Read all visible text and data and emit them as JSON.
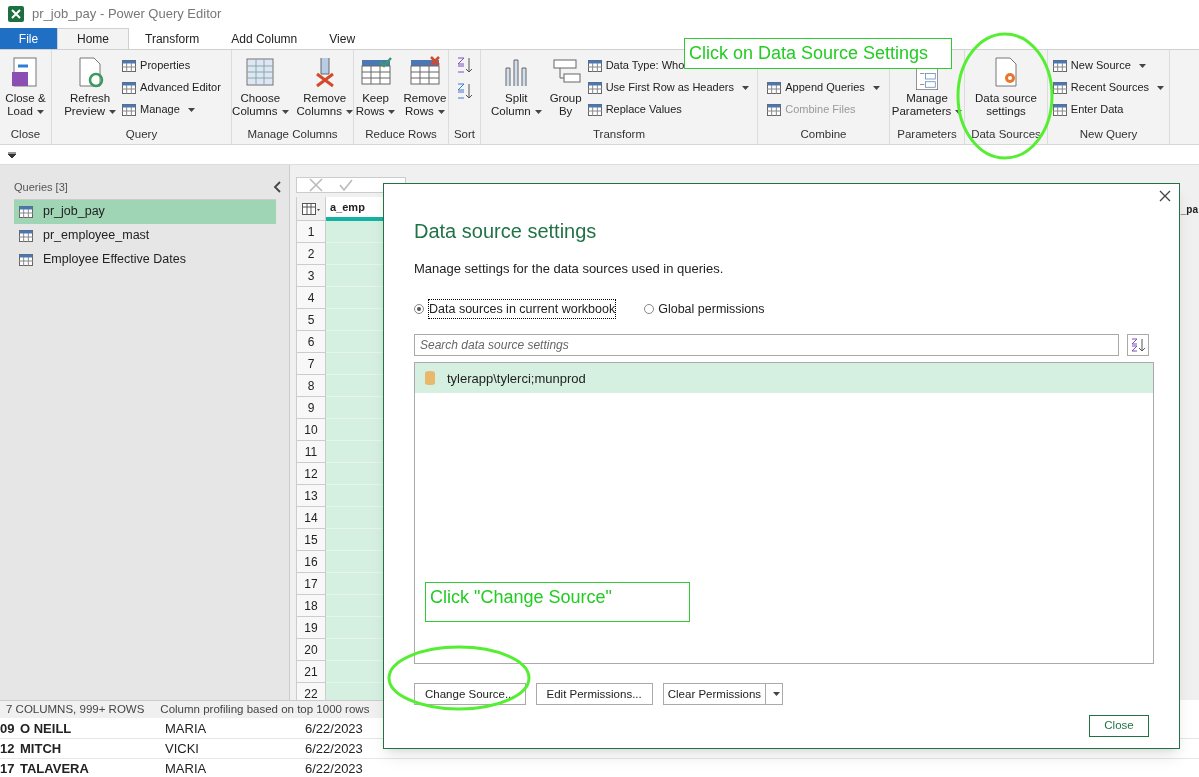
{
  "window": {
    "title": "pr_job_pay - Power Query Editor"
  },
  "tabs": [
    {
      "label": "File",
      "kind": "file",
      "selected": false
    },
    {
      "label": "Home",
      "kind": "tab",
      "selected": true
    },
    {
      "label": "Transform",
      "kind": "tab",
      "selected": false
    },
    {
      "label": "Add Column",
      "kind": "tab",
      "selected": false
    },
    {
      "label": "View",
      "kind": "tab",
      "selected": false
    }
  ],
  "ribbon_groups": [
    {
      "label": "Close",
      "items": [
        {
          "kind": "large",
          "lines": [
            "Close &",
            "Load"
          ],
          "dropdown": true
        }
      ]
    },
    {
      "label": "Query",
      "items": [
        {
          "kind": "large",
          "lines": [
            "Refresh",
            "Preview"
          ],
          "dropdown": true
        },
        {
          "kind": "stack",
          "items": [
            {
              "label": "Properties",
              "dropdown": false,
              "disabled": false
            },
            {
              "label": "Advanced Editor",
              "dropdown": false,
              "disabled": false
            },
            {
              "label": "Manage",
              "dropdown": true,
              "disabled": false
            }
          ]
        }
      ]
    },
    {
      "label": "Manage Columns",
      "items": [
        {
          "kind": "large",
          "lines": [
            "Choose",
            "Columns"
          ],
          "dropdown": true
        },
        {
          "kind": "large",
          "lines": [
            "Remove",
            "Columns"
          ],
          "dropdown": true
        }
      ]
    },
    {
      "label": "Reduce Rows",
      "items": [
        {
          "kind": "large",
          "lines": [
            "Keep",
            "Rows"
          ],
          "dropdown": true
        },
        {
          "kind": "large",
          "lines": [
            "Remove",
            "Rows"
          ],
          "dropdown": true
        }
      ]
    },
    {
      "label": "Sort",
      "items": [
        {
          "kind": "sort"
        }
      ]
    },
    {
      "label": "Transform",
      "items": [
        {
          "kind": "large",
          "lines": [
            "Split",
            "Column"
          ],
          "dropdown": true
        },
        {
          "kind": "large",
          "lines": [
            "Group",
            "By"
          ],
          "dropdown": false
        },
        {
          "kind": "stack",
          "items": [
            {
              "label": "Data Type: Who",
              "dropdown": false,
              "disabled": false
            },
            {
              "label": "Use First Row as Headers",
              "dropdown": true,
              "disabled": false
            },
            {
              "label": "Replace Values",
              "dropdown": false,
              "disabled": false
            }
          ]
        }
      ]
    },
    {
      "label": "Combine",
      "items": [
        {
          "kind": "stack",
          "items": [
            {
              "label": "Append Queries",
              "dropdown": true,
              "disabled": false
            },
            {
              "label": "Combine Files",
              "dropdown": false,
              "disabled": true
            }
          ]
        }
      ]
    },
    {
      "label": "Parameters",
      "items": [
        {
          "kind": "large",
          "lines": [
            "Manage",
            "Parameters"
          ],
          "dropdown": true
        }
      ]
    },
    {
      "label": "Data Sources",
      "items": [
        {
          "kind": "large",
          "lines": [
            "Data source",
            "settings"
          ],
          "dropdown": false
        }
      ]
    },
    {
      "label": "New Query",
      "items": [
        {
          "kind": "stack",
          "items": [
            {
              "label": "New Source",
              "dropdown": true,
              "disabled": false
            },
            {
              "label": "Recent Sources",
              "dropdown": true,
              "disabled": false
            },
            {
              "label": "Enter Data",
              "dropdown": false,
              "disabled": false
            }
          ]
        }
      ]
    }
  ],
  "queries": {
    "heading": "Queries [3]",
    "items": [
      {
        "label": "pr_job_pay",
        "selected": true
      },
      {
        "label": "pr_employee_mast",
        "selected": false
      },
      {
        "label": "Employee Effective Dates",
        "selected": false
      }
    ]
  },
  "grid": {
    "column_1": "a_emp",
    "column_2": "_pa",
    "row_numbers": [
      "1",
      "2",
      "3",
      "4",
      "5",
      "6",
      "7",
      "8",
      "9",
      "10",
      "11",
      "12",
      "13",
      "14",
      "15",
      "16",
      "17",
      "18",
      "19",
      "20",
      "21",
      "22"
    ]
  },
  "status_bar": {
    "columns": "7 COLUMNS, 999+ ROWS",
    "profiling": "Column profiling based on top 1000 rows"
  },
  "sheet_rows": [
    [
      "09",
      "O NEILL",
      "MARIA",
      "6/22/2023"
    ],
    [
      "12",
      "MITCH",
      "VICKI",
      "6/22/2023"
    ],
    [
      "17",
      "TALAVERA",
      "MARIA",
      "6/22/2023"
    ]
  ],
  "dialog": {
    "title": "Data source settings",
    "description": "Manage settings for the data sources used in queries.",
    "scopes": [
      {
        "label": "Data sources in current workbook",
        "selected": true
      },
      {
        "label": "Global permissions",
        "selected": false
      }
    ],
    "search": {
      "placeholder": "Search data source settings"
    },
    "sources": [
      {
        "label": "tylerapp\\tylerci;munprod",
        "selected": true
      }
    ],
    "buttons": [
      {
        "label": "Change Source...",
        "kind": "plain"
      },
      {
        "label": "Edit Permissions...",
        "kind": "plain"
      },
      {
        "label": "Clear Permissions",
        "kind": "split"
      }
    ],
    "close": "Close"
  },
  "callouts": [
    {
      "text": "Click on Data Source Settings"
    },
    {
      "text": "Click \"Change Source\""
    }
  ]
}
